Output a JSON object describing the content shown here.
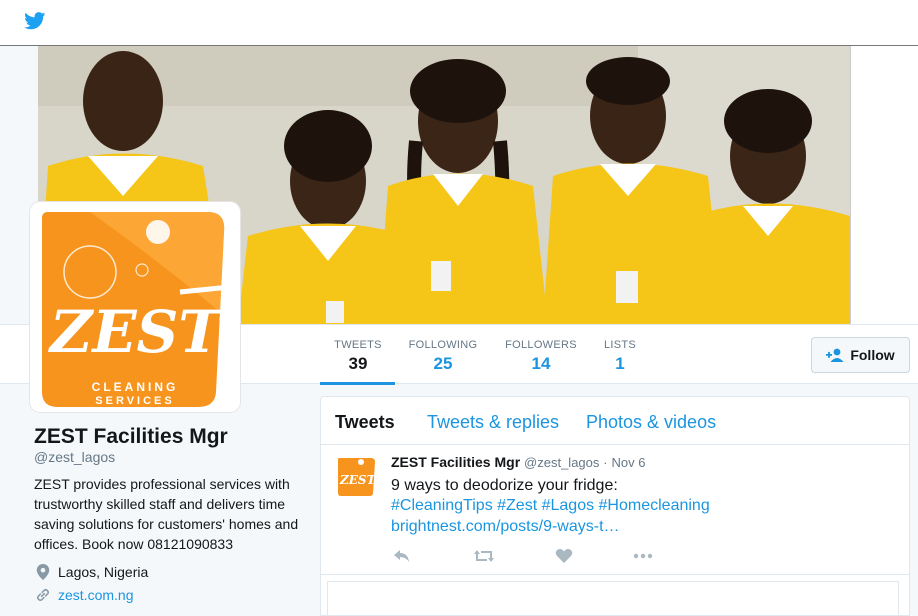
{
  "profile": {
    "name": "ZEST Facilities Mgr",
    "handle": "@zest_lagos",
    "bio": "ZEST provides professional services with trustworthy skilled staff and delivers time saving solutions for customers' homes and offices. Book now 08121090833",
    "location": "Lagos, Nigeria",
    "url": "zest.com.ng",
    "logo": {
      "word": "ZEST",
      "line1": "CLEANING",
      "line2": "SERVICES"
    }
  },
  "stats": [
    {
      "label": "TWEETS",
      "value": "39"
    },
    {
      "label": "FOLLOWING",
      "value": "25"
    },
    {
      "label": "FOLLOWERS",
      "value": "14"
    },
    {
      "label": "LISTS",
      "value": "1"
    }
  ],
  "follow_button": {
    "label": "Follow",
    "icon": "follow-user-icon"
  },
  "tabs": [
    "Tweets",
    "Tweets & replies",
    "Photos & videos"
  ],
  "tweet": {
    "name": "ZEST Facilities Mgr",
    "handle": "@zest_lagos",
    "separator": "·",
    "date": "Nov 6",
    "text": "9 ways to deodorize your fridge:",
    "hashtags": "#CleaningTips #Zest #Lagos #Homecleaning",
    "link": "brightnest.com/posts/9-ways-t…",
    "actions": [
      "reply-icon",
      "retweet-icon",
      "like-icon",
      "more-icon"
    ]
  },
  "colors": {
    "brand_orange": "#f7941d",
    "link_blue": "#1b95e0",
    "shirt_yellow": "#f5c518"
  }
}
